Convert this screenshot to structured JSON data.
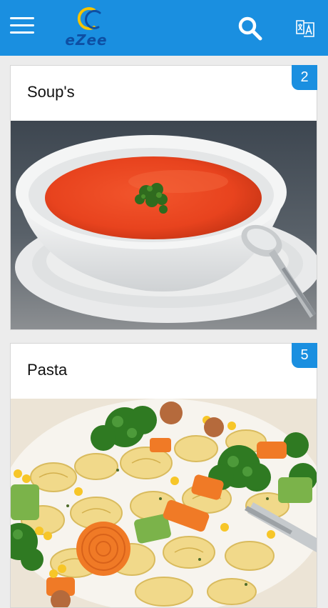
{
  "header": {
    "logo_text": "eZee",
    "colors": {
      "bar": "#1a8fe0",
      "logo": "#0e4fa3"
    },
    "icons": [
      "menu-icon",
      "search-icon",
      "translate-icon"
    ]
  },
  "categories": [
    {
      "title": "Soup's",
      "count": "2"
    },
    {
      "title": "Pasta",
      "count": "5"
    }
  ]
}
